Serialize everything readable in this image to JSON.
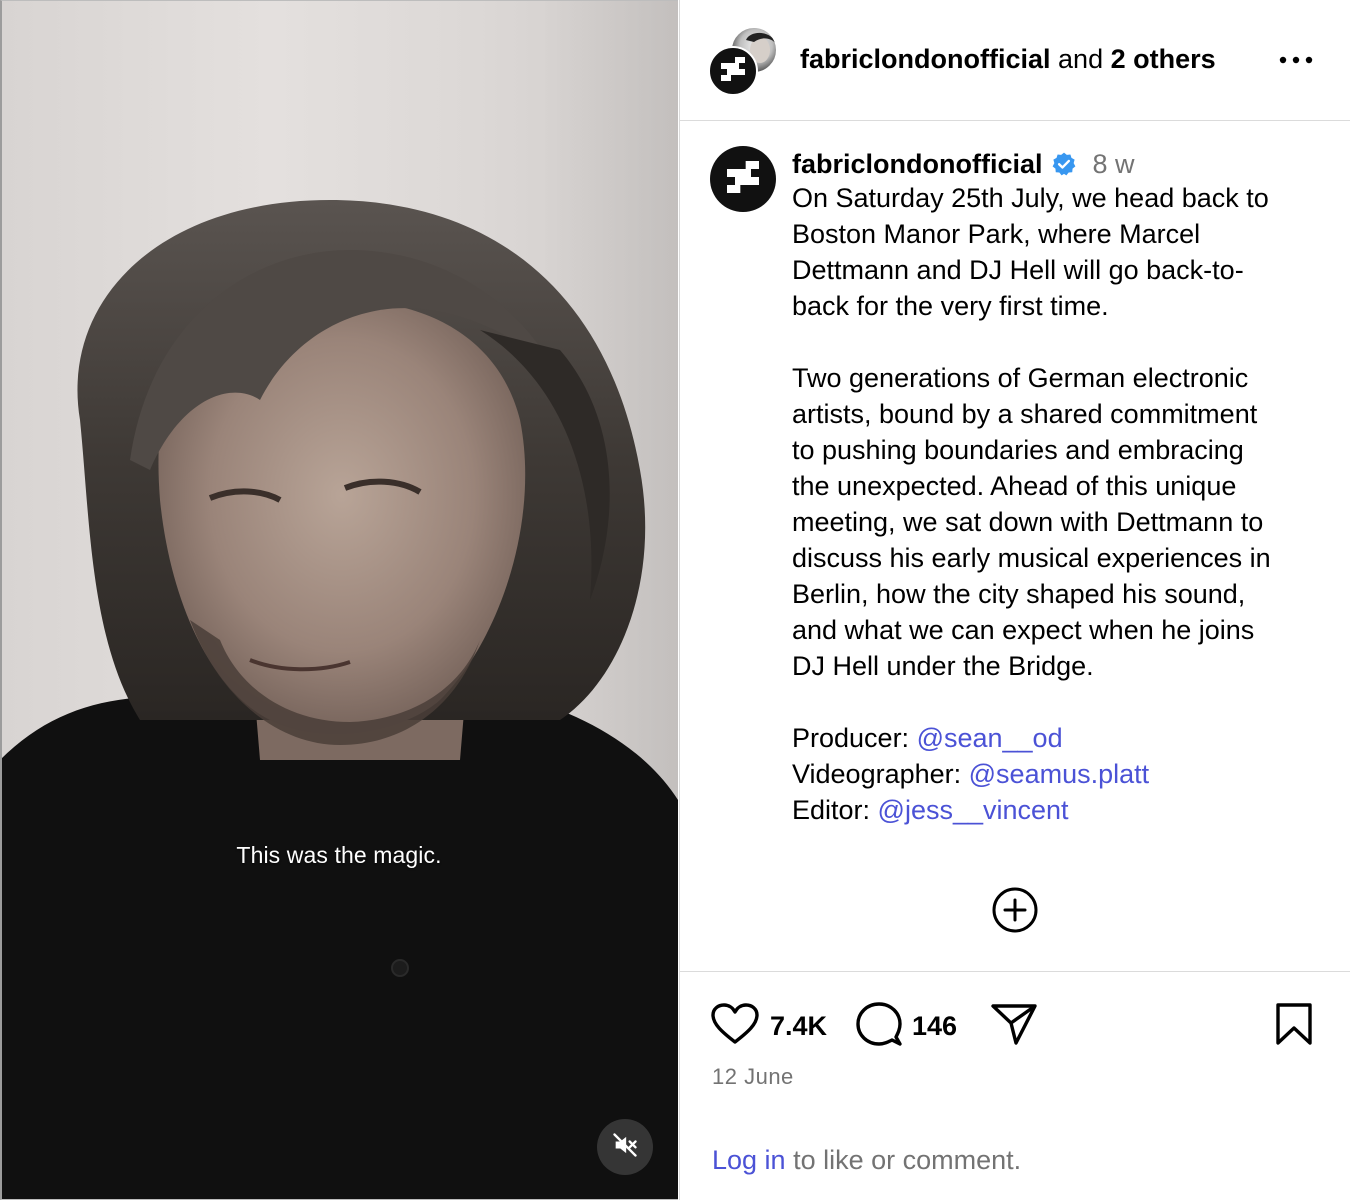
{
  "media": {
    "caption": "This was the magic.",
    "mute_icon": "speaker-muted-icon"
  },
  "header": {
    "username": "fabriclondonofficial",
    "and_text": "and",
    "others": "2 others",
    "more_icon": "more-horizontal-icon"
  },
  "post": {
    "username": "fabriclondonofficial",
    "verified_icon": "verified-badge-icon",
    "time": "8 w",
    "paragraphs": [
      [
        "On Saturday 25th July, we head back to",
        "Boston Manor Park, where Marcel",
        "Dettmann and DJ Hell will go back-to-",
        "back for the very first time."
      ],
      [
        "Two generations of German electronic",
        "artists, bound by a shared commitment",
        "to pushing boundaries and embracing",
        "the unexpected. Ahead of this unique",
        "meeting, we sat down with Dettmann to",
        "discuss his early musical experiences in",
        "Berlin, how the city shaped his sound,",
        "and what we can expect when he joins",
        "DJ Hell under the Bridge."
      ]
    ],
    "credits": [
      {
        "label": "Producer: ",
        "handle": "@sean__od"
      },
      {
        "label": "Videographer: ",
        "handle": "@seamus.platt"
      },
      {
        "label": "Editor: ",
        "handle": "@jess__vincent"
      }
    ],
    "load_more_icon": "plus-circle-icon"
  },
  "actions": {
    "likes": "7.4K",
    "comments": "146",
    "like_icon": "heart-icon",
    "comment_icon": "comment-icon",
    "share_icon": "send-icon",
    "save_icon": "bookmark-icon"
  },
  "date": "12 June",
  "login": {
    "link": "Log in",
    "rest": " to like or comment."
  },
  "colors": {
    "link": "#4b52d6",
    "muted": "#737373",
    "verified": "#3897f0",
    "divider": "#dbdbdb"
  }
}
